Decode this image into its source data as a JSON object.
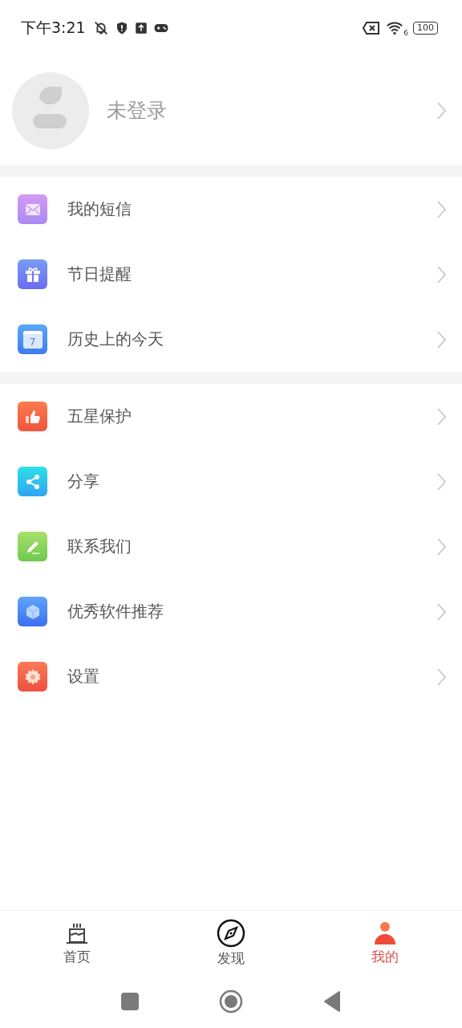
{
  "status_bar": {
    "time": "下午3:21",
    "wifi_label": "6",
    "battery": "100"
  },
  "profile": {
    "name": "未登录"
  },
  "menu_groups": [
    [
      {
        "kind": "mail",
        "label": "我的短信"
      },
      {
        "kind": "gift",
        "label": "节日提醒"
      },
      {
        "kind": "calendar",
        "label": "历史上的今天",
        "calendar_day": "7"
      }
    ],
    [
      {
        "kind": "thumb",
        "label": "五星保护"
      },
      {
        "kind": "share",
        "label": "分享"
      },
      {
        "kind": "pen",
        "label": "联系我们"
      },
      {
        "kind": "cube",
        "label": "优秀软件推荐"
      },
      {
        "kind": "gear",
        "label": "设置"
      }
    ]
  ],
  "tabs": [
    {
      "kind": "cake",
      "label": "首页",
      "selected": false
    },
    {
      "kind": "compass",
      "label": "发现",
      "selected": false
    },
    {
      "kind": "person",
      "label": "我的",
      "selected": true
    }
  ]
}
